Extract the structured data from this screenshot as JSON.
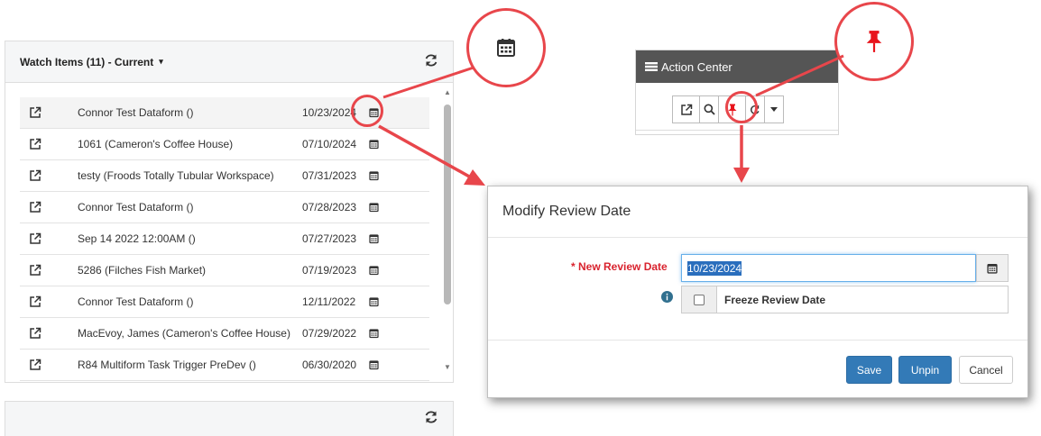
{
  "watch_panel": {
    "title": "Watch Items (11) - Current",
    "caret": "▾",
    "rows": [
      {
        "name": "Connor Test Dataform ()",
        "date": "10/23/2024"
      },
      {
        "name": "1061 (Cameron's Coffee House)",
        "date": "07/10/2024"
      },
      {
        "name": "testy (Froods Totally Tubular Workspace)",
        "date": "07/31/2023"
      },
      {
        "name": "Connor Test Dataform ()",
        "date": "07/28/2023"
      },
      {
        "name": "Sep 14 2022 12:00AM ()",
        "date": "07/27/2023"
      },
      {
        "name": "5286 (Filches Fish Market)",
        "date": "07/19/2023"
      },
      {
        "name": "Connor Test Dataform ()",
        "date": "12/11/2022"
      },
      {
        "name": "MacEvoy, James (Cameron's Coffee House)",
        "date": "07/29/2022"
      },
      {
        "name": "R84 Multiform Task Trigger PreDev ()",
        "date": "06/30/2020"
      }
    ]
  },
  "action_center": {
    "title": "Action Center"
  },
  "modal": {
    "title": "Modify Review Date",
    "new_review_date_label": "* New Review Date",
    "new_review_date_value": "10/23/2024",
    "freeze_label": "Freeze Review Date",
    "save": "Save",
    "unpin": "Unpin",
    "cancel": "Cancel"
  },
  "colors": {
    "annotation": "#e8464b",
    "primary": "#337ab7",
    "pin": "#e8141c",
    "required": "#d9232e",
    "action_header": "#555555"
  },
  "icons": [
    "calendar-icon",
    "pin-icon",
    "refresh-icon",
    "external-link-icon",
    "search-icon",
    "info-icon",
    "bars-icon"
  ]
}
